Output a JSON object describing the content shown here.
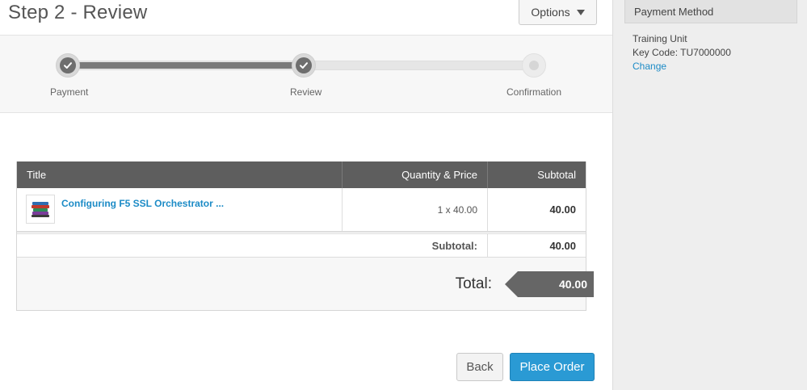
{
  "page": {
    "title": "Step 2 - Review"
  },
  "options": {
    "label": "Options"
  },
  "steps": [
    {
      "label": "Payment",
      "state": "done"
    },
    {
      "label": "Review",
      "state": "done"
    },
    {
      "label": "Confirmation",
      "state": "todo"
    }
  ],
  "cart": {
    "headers": {
      "title": "Title",
      "qty_price": "Quantity & Price",
      "subtotal": "Subtotal"
    },
    "items": [
      {
        "title": "Configuring F5 SSL Orchestrator ...",
        "qty_price": "1 x 40.00",
        "subtotal": "40.00",
        "icon": "books-icon"
      }
    ],
    "subtotal_label": "Subtotal:",
    "subtotal_value": "40.00",
    "total_label": "Total:",
    "total_value": "40.00"
  },
  "buttons": {
    "back": "Back",
    "place_order": "Place Order"
  },
  "sidebar": {
    "heading": "Payment Method",
    "line1": "Training Unit",
    "line2": "Key Code: TU7000000",
    "change": "Change"
  },
  "colors": {
    "accent": "#2a9ad4",
    "link": "#1c8bc6",
    "header_bg": "#5e5e5e"
  }
}
